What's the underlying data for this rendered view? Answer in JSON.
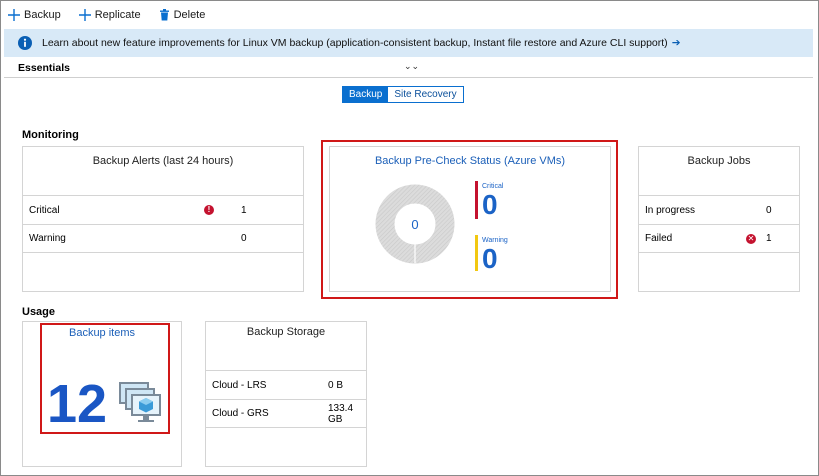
{
  "toolbar": {
    "backup_label": "Backup",
    "replicate_label": "Replicate",
    "delete_label": "Delete"
  },
  "banner": {
    "text": "Learn about new feature improvements for Linux VM backup (application-consistent backup, Instant file restore and Azure CLI support)",
    "arrow": "➔"
  },
  "essentials": {
    "label": "Essentials",
    "chevron": "⌄⌄"
  },
  "toggle": {
    "backup_label": "Backup",
    "site_recovery_label": "Site Recovery",
    "selected": "Backup"
  },
  "monitoring": {
    "section_title": "Monitoring",
    "alerts": {
      "title": "Backup Alerts (last 24 hours)",
      "rows": [
        {
          "label": "Critical",
          "value": "1",
          "icon": "alert-error-icon",
          "icon_glyph": "!"
        },
        {
          "label": "Warning",
          "value": "0"
        }
      ]
    },
    "precheck": {
      "title": "Backup Pre-Check Status (Azure VMs)",
      "donut_total": "0",
      "critical_label": "Critical",
      "critical_value": "0",
      "warning_label": "Warning",
      "warning_value": "0"
    },
    "jobs": {
      "title": "Backup Jobs",
      "rows": [
        {
          "label": "In progress",
          "value": "0"
        },
        {
          "label": "Failed",
          "value": "1",
          "icon": "failed-x-icon",
          "icon_glyph": "✕"
        }
      ]
    }
  },
  "usage": {
    "section_title": "Usage",
    "items": {
      "title": "Backup items",
      "count": "12",
      "icon": "virtual-machines-icon"
    },
    "storage": {
      "title": "Backup Storage",
      "rows": [
        {
          "label": "Cloud - LRS",
          "value": "0 B"
        },
        {
          "label": "Cloud - GRS",
          "value": "133.4 GB"
        }
      ]
    }
  },
  "colors": {
    "accent": "#0a6fcf",
    "link": "#1b5fb8",
    "banner_bg": "#d8e9f7",
    "highlight": "#d01818",
    "critical": "#c4122f",
    "warning": "#f2c811"
  }
}
